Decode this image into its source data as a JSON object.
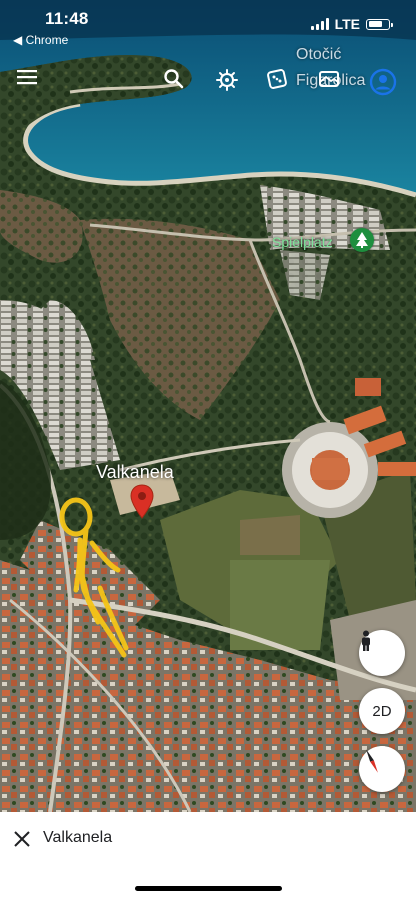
{
  "status_bar": {
    "time": "11:48",
    "back_label": "◀ Chrome",
    "network": "LTE"
  },
  "map": {
    "labels": {
      "islet": "Otočić Figarolica",
      "playground": "Spielplatz",
      "place": "Valkanela"
    },
    "colors": {
      "sea": "#0f6a8d",
      "forest": "#2f4a22",
      "pin": "#d93025",
      "annotation": "#f5c518",
      "accent": "#1a73e8"
    }
  },
  "toolbar": {
    "icons": [
      "menu-icon",
      "search-icon",
      "voyager-icon",
      "dice-icon",
      "layers-icon",
      "account-icon"
    ]
  },
  "controls": {
    "view_mode": "2D"
  },
  "bottom_sheet": {
    "title": "Valkanela"
  }
}
